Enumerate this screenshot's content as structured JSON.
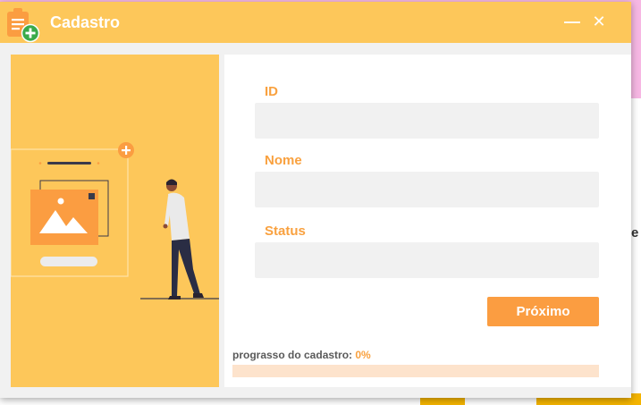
{
  "window": {
    "title": "Cadastro",
    "minimize_glyph": "—",
    "close_glyph": "✕",
    "icon": "document-add-icon"
  },
  "form": {
    "id_label": "ID",
    "id_value": "",
    "nome_label": "Nome",
    "nome_value": "",
    "status_label": "Status",
    "status_value": "",
    "next_label": "Próximo"
  },
  "progress": {
    "label": "prograsso do cadastro:",
    "value_text": "0%",
    "fraction": 0
  },
  "colors": {
    "accent": "#fdc75a",
    "button": "#fb9d41",
    "label": "#f9a13f",
    "track": "#fde3cc"
  },
  "illustration": {
    "icons": [
      "image-card-icon",
      "plus-icon",
      "person-icon"
    ]
  },
  "background": {
    "edge_text": "e"
  }
}
